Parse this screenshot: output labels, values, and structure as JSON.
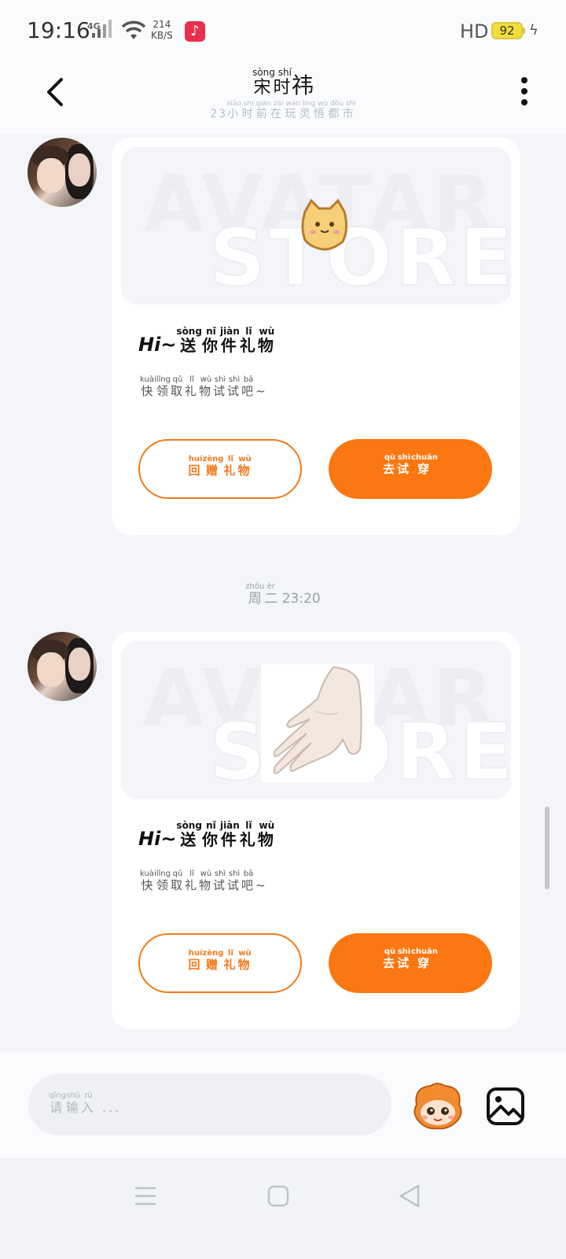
{
  "status_bar": {
    "time": "19:16",
    "network": "4G",
    "speed_value": "214",
    "speed_unit": "KB/S",
    "hd": "HD",
    "battery": "92"
  },
  "header": {
    "title_pinyin": "sòng shí",
    "title_han": "宋时",
    "title_extra": "祎",
    "subtitle_prefix": "23",
    "subtitle_pinyin": "xiǎo shí qián zài wán líng wù dōu shì",
    "subtitle_han": "小时前在玩灵悟都市"
  },
  "messages": [
    {
      "gift_name": "cat-bread-sticker",
      "heading_prefix": "Hi~",
      "heading_pinyin": [
        "sòng",
        "nǐ",
        "jiàn",
        "lǐ",
        "wù"
      ],
      "heading_han": [
        "送",
        "你",
        "件",
        "礼",
        "物"
      ],
      "desc_pinyin": [
        "kuài",
        "lǐng",
        "qǔ",
        "lǐ",
        "wù",
        "shì",
        "shì",
        "bā"
      ],
      "desc_han": [
        "快",
        "领",
        "取",
        "礼",
        "物",
        "试",
        "试",
        "吧"
      ],
      "desc_suffix": "~",
      "return_pinyin": [
        "huí",
        "zèng",
        "lǐ",
        "wù"
      ],
      "return_han": [
        "回",
        "赠",
        "礼",
        "物"
      ],
      "try_pinyin": [
        "qù",
        "shì",
        "chuān"
      ],
      "try_han": [
        "去",
        "试",
        "穿"
      ]
    },
    {
      "gift_name": "white-glove",
      "heading_prefix": "Hi~",
      "heading_pinyin": [
        "sòng",
        "nǐ",
        "jiàn",
        "lǐ",
        "wù"
      ],
      "heading_han": [
        "送",
        "你",
        "件",
        "礼",
        "物"
      ],
      "desc_pinyin": [
        "kuài",
        "lǐng",
        "qǔ",
        "lǐ",
        "wù",
        "shì",
        "shì",
        "bā"
      ],
      "desc_han": [
        "快",
        "领",
        "取",
        "礼",
        "物",
        "试",
        "试",
        "吧"
      ],
      "desc_suffix": "~",
      "return_pinyin": [
        "huí",
        "zèng",
        "lǐ",
        "wù"
      ],
      "return_han": [
        "回",
        "赠",
        "礼",
        "物"
      ],
      "try_pinyin": [
        "qù",
        "shì",
        "chuān"
      ],
      "try_han": [
        "去",
        "试",
        "穿"
      ]
    }
  ],
  "banner_watermark": [
    "AVATAR",
    "STORE"
  ],
  "time_divider": {
    "pinyin": [
      "zhōu",
      "èr"
    ],
    "han": [
      "周",
      "二"
    ],
    "time": "23:20"
  },
  "input": {
    "placeholder_pinyin": [
      "qǐng",
      "shū",
      "rù"
    ],
    "placeholder_han": [
      "请",
      "输",
      "入"
    ],
    "placeholder_suffix": "..."
  },
  "colors": {
    "accent": "#fb7711",
    "page_bg": "#f3f5f8",
    "card_bg": "#ffffff"
  }
}
